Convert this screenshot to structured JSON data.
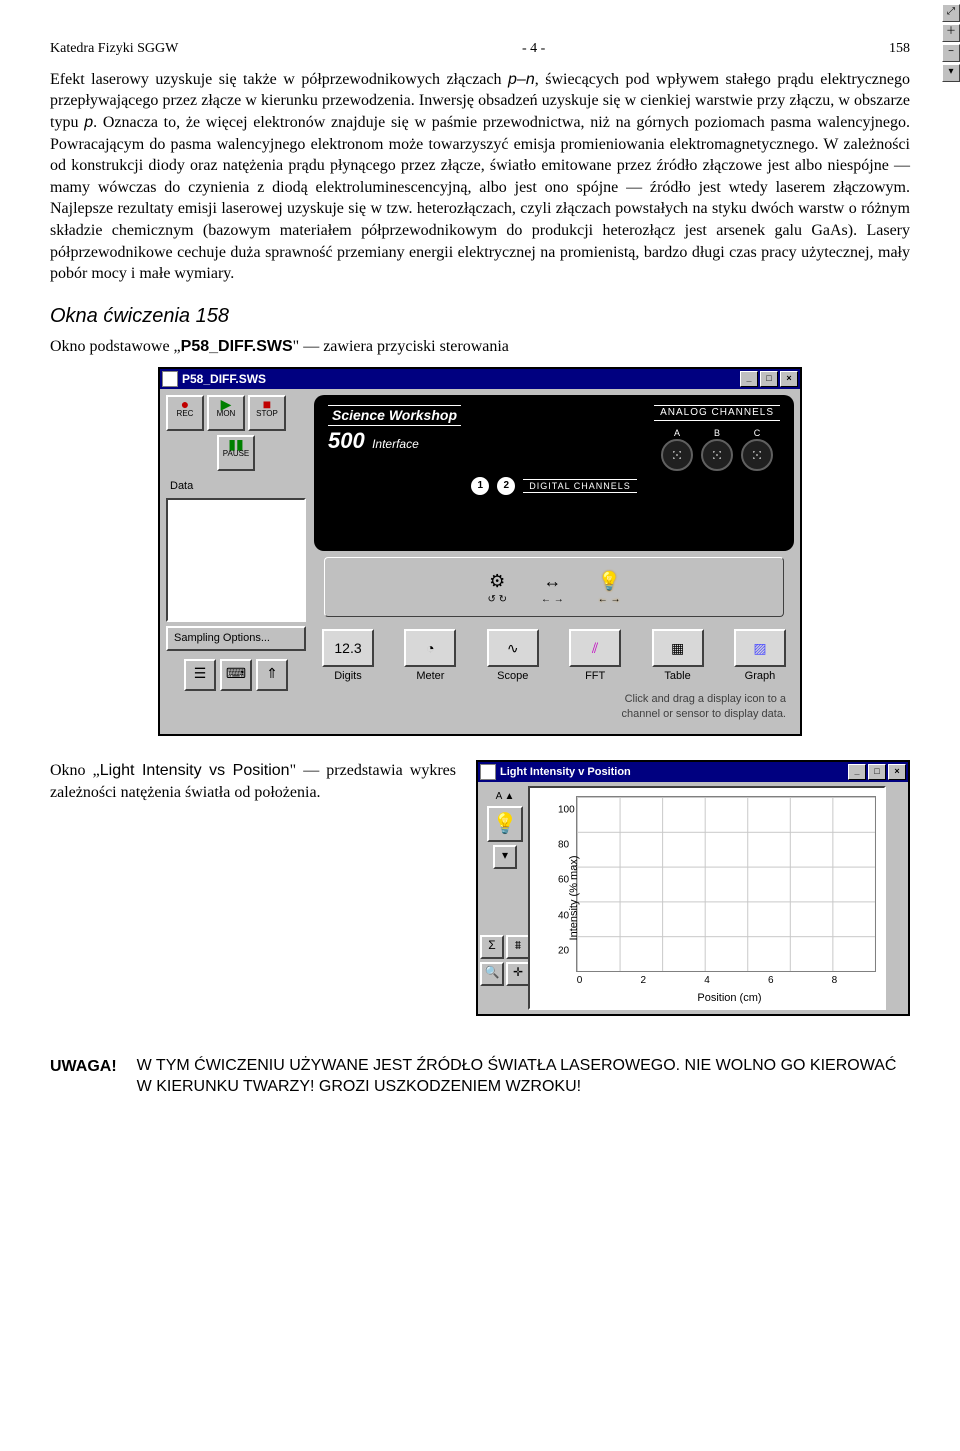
{
  "header": {
    "left": "Katedra Fizyki SGGW",
    "center": "- 4 -",
    "right": "158"
  },
  "para1_a": "Efekt laserowy uzyskuje się także w półprzewodnikowych złączach ",
  "para1_pn": "p–n",
  "para1_b": ", świecących pod wpływem stałego prądu elektrycznego przepływającego przez złącze w kierunku przewodzenia. Inwersję obsadzeń uzyskuje się w cienkiej warstwie przy złączu, w obszarze typu ",
  "para1_p": "p",
  "para1_c": ". Oznacza to, że więcej elektronów znajduje się w paśmie przewodnictwa, niż na górnych poziomach pasma walencyjnego. Powracającym do pasma walencyjnego elektronom może towarzyszyć emisja promieniowania elektromagnetycznego. W zależności od konstrukcji diody oraz natężenia prądu płynącego przez złącze, światło emitowane przez źródło złączowe jest albo niespójne — mamy wówczas do czynienia z diodą elektroluminescencyjną, albo jest ono spójne — źródło jest wtedy laserem złączowym. Najlepsze rezultaty emisji laserowej uzyskuje się w tzw. heterozłączach, czyli złączach powstałych na styku dwóch warstw o różnym składzie chemicznym (bazowym materiałem półprzewodnikowym do produkcji heterozłącz jest arsenek galu GaAs). Lasery półprzewodnikowe cechuje duża sprawność przemiany energii elektrycznej na promienistą, bardzo długi czas pracy użytecznej, mały pobór mocy i małe wymiary.",
  "section": "Okna ćwiczenia 158",
  "subline_a": "Okno podstawowe „",
  "subline_name": "P58_DIFF.SWS",
  "subline_b": "\" — zawiera przyciski sterowania",
  "win_p58": {
    "title": "P58_DIFF.SWS",
    "rec": "REC",
    "mon": "MON",
    "stop": "STOP",
    "pause": "PAUSE",
    "data": "Data",
    "sampling": "Sampling Options...",
    "brand_sw": "Science Workshop",
    "brand_500": "500",
    "brand_intf": "Interface",
    "analog": "ANALOG CHANNELS",
    "chA": "A",
    "chB": "B",
    "chC": "C",
    "digital": "DIGITAL CHANNELS",
    "d1": "1",
    "d2": "2",
    "disp_digits_val": "12.3",
    "disp_digits": "Digits",
    "disp_meter": "Meter",
    "disp_scope": "Scope",
    "disp_fft": "FFT",
    "disp_table": "Table",
    "disp_graph": "Graph",
    "hint": "Click and drag a display icon to a\nchannel or sensor to display data."
  },
  "two_col_text_a": "Okno „",
  "two_col_name": "Light Intensity vs Position",
  "two_col_text_b": "\" — przedstawia wykres zależności natężenia światła od położenia.",
  "win_int": {
    "title": "Light Intensity v Position",
    "chA": "A ▲",
    "ylabel": "Intensity (% max)",
    "xlabel": "Position (cm)",
    "yticks": [
      "20",
      "40",
      "60",
      "80",
      "100"
    ],
    "xticks": [
      "0",
      "2",
      "4",
      "6",
      "8"
    ]
  },
  "footer": {
    "uw": "UWAGA!",
    "msg": "W TYM ĆWICZENIU UŻYWANE JEST ŹRÓDŁO ŚWIATŁA LASEROWEGO. NIE WOLNO GO KIEROWAĆ W KIERUNKU TWARZY! GROZI USZKODZENIEM WZROKU!"
  }
}
